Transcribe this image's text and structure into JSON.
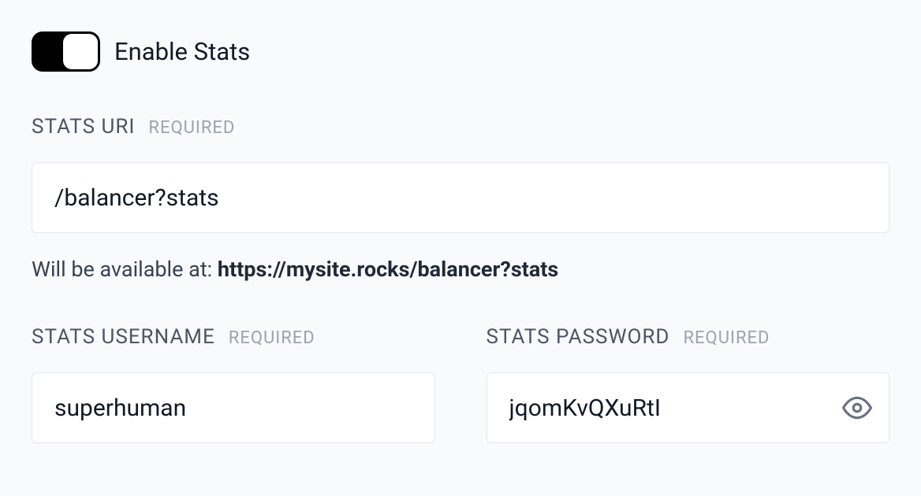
{
  "enableStats": {
    "label": "Enable Stats",
    "checked": true
  },
  "statsUri": {
    "label": "STATS URI",
    "requiredTag": "REQUIRED",
    "value": "/balancer?stats",
    "hintPrefix": "Will be available at: ",
    "hintUrl": "https://mysite.rocks/balancer?stats"
  },
  "statsUsername": {
    "label": "STATS USERNAME",
    "requiredTag": "REQUIRED",
    "value": "superhuman"
  },
  "statsPassword": {
    "label": "STATS PASSWORD",
    "requiredTag": "REQUIRED",
    "value": "jqomKvQXuRtI"
  }
}
